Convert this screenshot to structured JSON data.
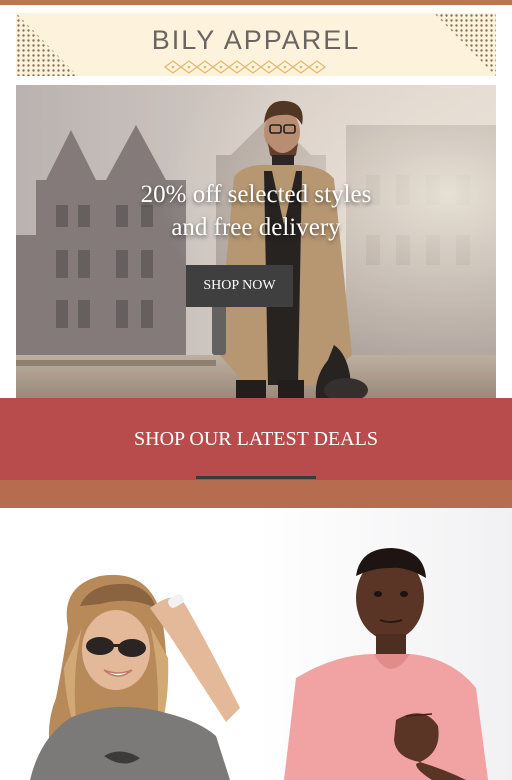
{
  "brand": {
    "name": "BILY APPAREL",
    "ornament_icon": "diamond-lattice-ornament-icon",
    "colors": {
      "banner": "#fdf2dc",
      "text": "#6a6462",
      "gold": "#e0b870"
    }
  },
  "hero": {
    "headline_line1": "20% off selected styles",
    "headline_line2": "and free delivery",
    "cta_label": "SHOP NOW"
  },
  "deals": {
    "title": "SHOP OUR LATEST DEALS",
    "colors": {
      "band": "#b84c4c",
      "copper": "#b66d4f"
    }
  },
  "products": [
    {
      "name": "woman-in-sunglasses-photo"
    },
    {
      "name": "man-in-pink-tee-photo"
    }
  ]
}
